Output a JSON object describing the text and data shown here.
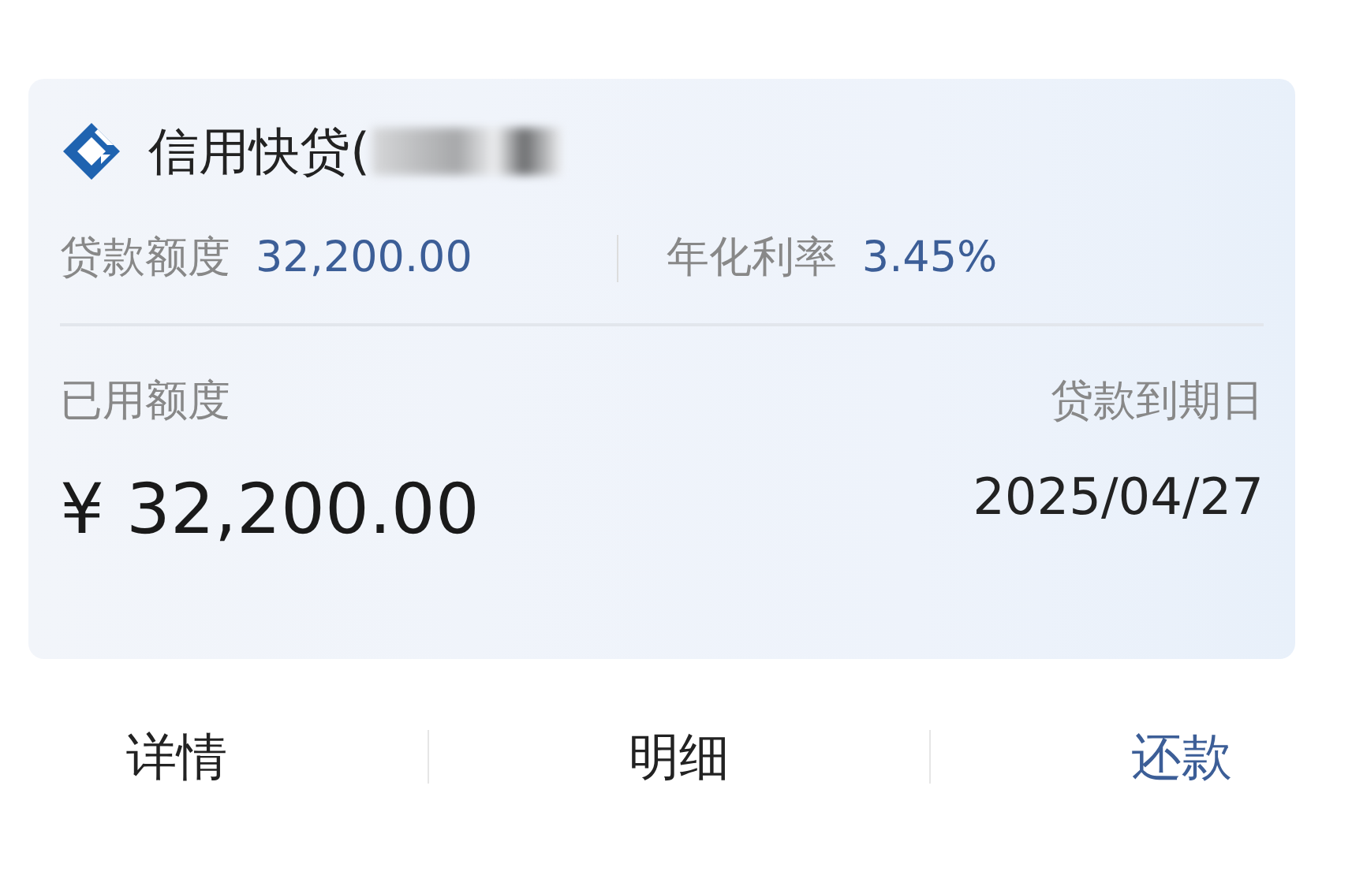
{
  "product": {
    "title": "信用快贷(",
    "redacted": true
  },
  "summary": [
    {
      "label": "贷款额度",
      "value": "32,200.00"
    },
    {
      "label": "年化利率",
      "value": "3.45%"
    }
  ],
  "used": {
    "label": "已用额度",
    "amount": "¥ 32,200.00"
  },
  "due": {
    "label": "贷款到期日",
    "date": "2025/04/27"
  },
  "actions": [
    {
      "label": "详情",
      "primary": false
    },
    {
      "label": "明细",
      "primary": false
    },
    {
      "label": "还款",
      "primary": true
    }
  ]
}
